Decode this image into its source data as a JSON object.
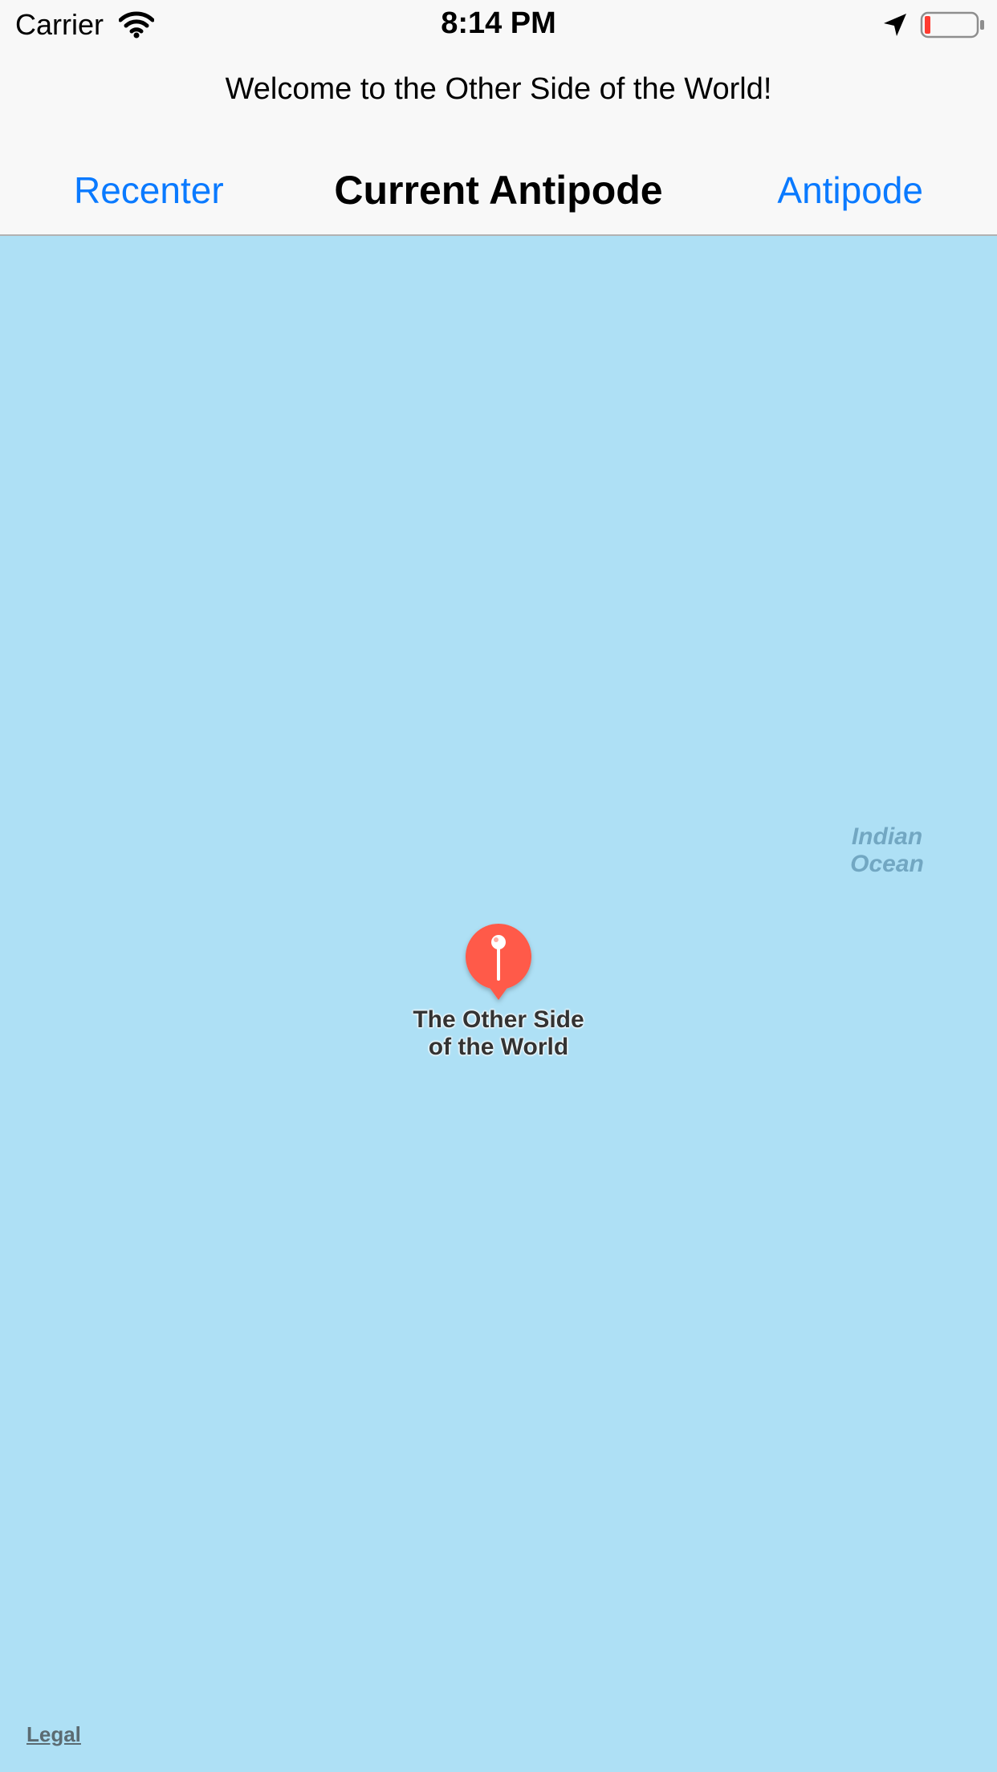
{
  "status_bar": {
    "carrier": "Carrier",
    "time": "8:14 PM",
    "icons": [
      "wifi-icon",
      "location-arrow-icon",
      "battery-icon"
    ],
    "battery_color": "#ff3b30"
  },
  "header": {
    "welcome_text": "Welcome to the Other Side of the World!",
    "title": "Current Antipode",
    "left_button": "Recenter",
    "right_button": "Antipode",
    "accent_color": "#0a7aff"
  },
  "map": {
    "water_color": "#aee0f5",
    "ocean_label_line1": "Indian",
    "ocean_label_line2": "Ocean",
    "pin": {
      "icon": "map-pin-icon",
      "color": "#ff5a48",
      "title_line1": "The Other Side",
      "title_line2": "of the World"
    },
    "legal_link": "Legal"
  }
}
